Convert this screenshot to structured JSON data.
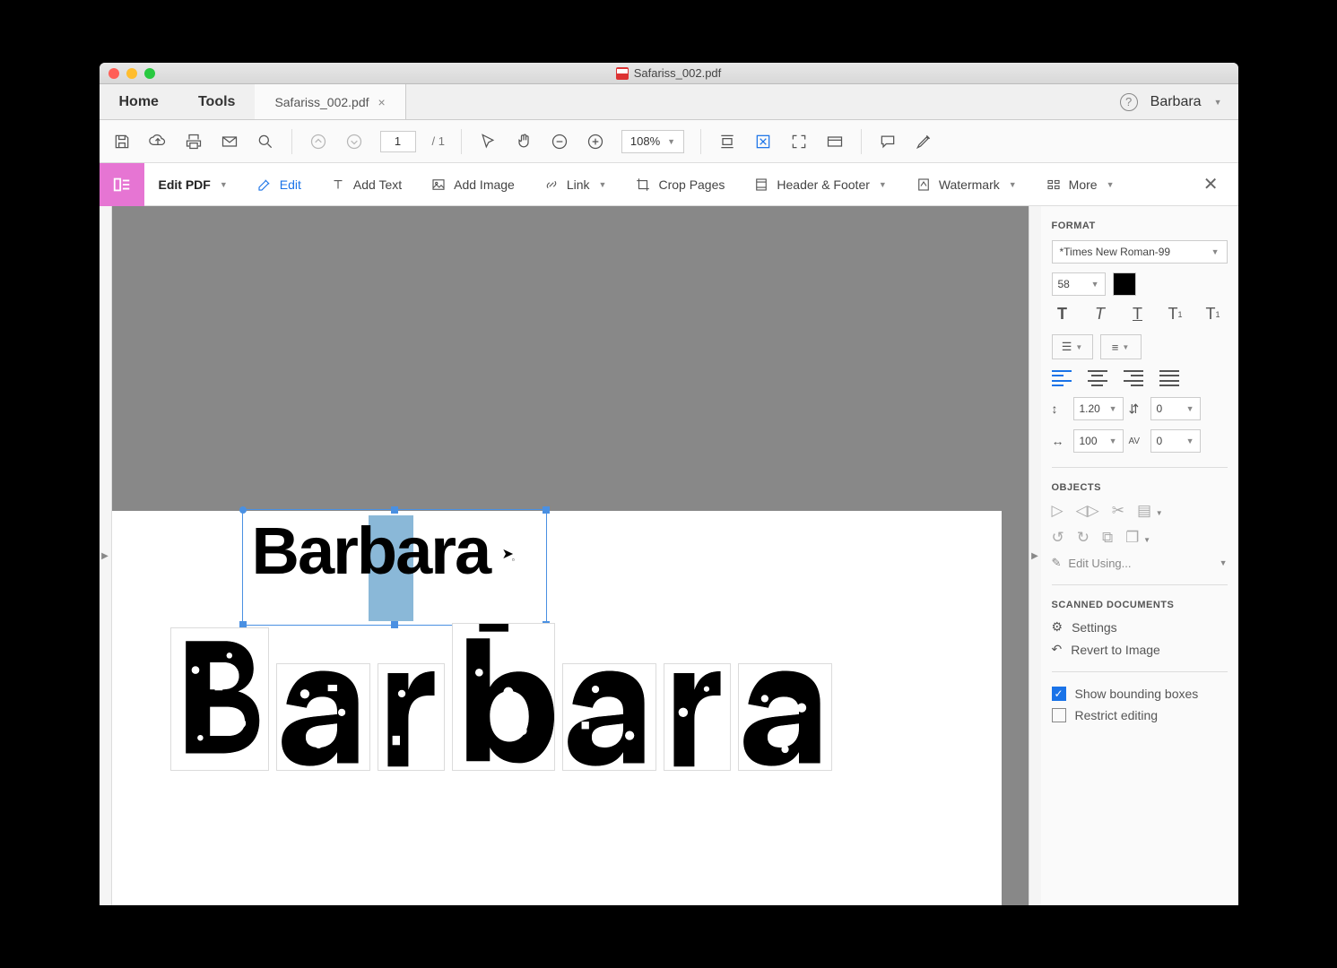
{
  "window": {
    "title": "Safariss_002.pdf"
  },
  "app_tabs": {
    "home": "Home",
    "tools": "Tools",
    "doc": "Safariss_002.pdf",
    "account": "Barbara"
  },
  "toolbar": {
    "page_current": "1",
    "page_total": "/ 1",
    "zoom": "108%"
  },
  "edit_bar": {
    "edit_pdf": "Edit PDF",
    "edit": "Edit",
    "add_text": "Add Text",
    "add_image": "Add Image",
    "link": "Link",
    "crop": "Crop Pages",
    "header_footer": "Header & Footer",
    "watermark": "Watermark",
    "more": "More"
  },
  "canvas": {
    "selected_text": "Barbara",
    "glyphs": [
      "B",
      "a",
      "r",
      "b",
      "a",
      "r",
      "a"
    ]
  },
  "format": {
    "heading": "FORMAT",
    "font": "*Times New Roman-99",
    "size": "58",
    "line_height": "1.20",
    "para_spacing": "0",
    "horiz_scale": "100",
    "char_spacing": "0"
  },
  "objects": {
    "heading": "OBJECTS",
    "edit_using": "Edit Using..."
  },
  "scanned": {
    "heading": "SCANNED DOCUMENTS",
    "settings": "Settings",
    "revert": "Revert to Image"
  },
  "options": {
    "show_bb": "Show bounding boxes",
    "restrict": "Restrict editing"
  }
}
